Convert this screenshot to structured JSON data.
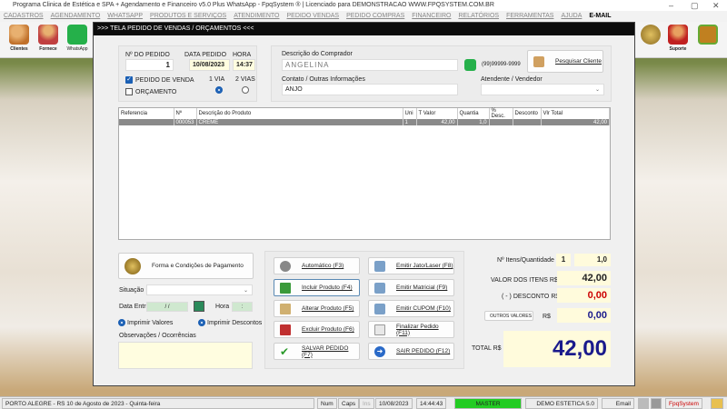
{
  "window": {
    "title": "Programa Clinica de Estética e SPA + Agendamento e Financeiro v5.0 Plus WhatsApp - FpqSystem ® | Licenciado para  DEMONSTRACAO WWW.FPQSYSTEM.COM.BR",
    "minimize": "–",
    "maximize": "▢",
    "close": "✕"
  },
  "menu": [
    "CADASTROS",
    "AGENDAMENTO",
    "WHATSAPP",
    "PRODUTOS E SERVIÇOS",
    "ATENDIMENTO",
    "PEDIDO VENDAS",
    "PEDIDO COMPRAS",
    "FINANCEIRO",
    "RELATÓRIOS",
    "FERRAMENTAS",
    "AJUDA"
  ],
  "menu_email": "E-MAIL",
  "toolbar": {
    "clientes": "Clientes",
    "fornece": "Fornece",
    "whatsapp": "WhatsApp",
    "suporte": "Suporte"
  },
  "modal": {
    "title": ">>>  TELA PEDIDO DE VENDAS / ORÇAMENTOS  <<<",
    "order_no_label": "Nº DO PEDIDO",
    "order_no": "1",
    "date_label": "DATA PEDIDO",
    "date": "10/08/2023",
    "time_label": "HORA",
    "time": "14:37",
    "sale_order": "PEDIDO DE VENDA",
    "quote": "ORÇAMENTO",
    "via1": "1 VIA",
    "via2": "2 VIAS",
    "buyer_label": "Descrição do Comprador",
    "buyer": "ANGELINA",
    "phone": "(99)99999-9999",
    "search_client": "Pesquisar Cliente",
    "contact_label": "Contato / Outras Informações",
    "contact": "ANJO",
    "seller_label": "Atendente / Vendedor",
    "seller": "",
    "table": {
      "headers": [
        "Referencia",
        "Nº",
        "Descrição do Produto",
        "Uni",
        "T Valor",
        "Quantia",
        "% Desc.",
        "Desconto",
        "Vlr Total"
      ],
      "rows": [
        [
          "",
          "000053",
          "CREME",
          "",
          "1",
          "42,00",
          "1,0",
          "",
          "",
          "42,00"
        ]
      ]
    },
    "payment_button": "Forma e Condições de Pagamento",
    "status_label": "Situação",
    "status": "",
    "delivery_label": "Data Entrega",
    "delivery_date": " / / ",
    "hour_label": "Hora",
    "hour": ":",
    "print_values": "Imprimir Valores",
    "print_discounts": "Imprimir Descontos",
    "notes_label": "Observações / Ocorrências",
    "notes": "",
    "buttons": {
      "auto": "Automático   (F3)",
      "include": "Incluir Produto  (F4)",
      "alter": "Alterar Produto  (F5)",
      "delete": "Excluir Produto  (F6)",
      "save": "SALVAR PEDIDO (F7)",
      "jet": "Emitir Jato/Laser (F8)",
      "matrix": "Emitir Matricial  (F9)",
      "coupon": "Emitir CUPOM  (F10)",
      "finish": "Finalizar Pedido  (F11)",
      "exit": "SAIR  PEDIDO  (F12)"
    },
    "items_label": "Nº Itens/Quantidade",
    "items_count": "1",
    "items_qty": "1,0",
    "items_value_label": "VALOR DOS ITENS R$",
    "items_value": "42,00",
    "discount_label": "( - ) DESCONTO R$",
    "discount": "0,00",
    "other_button": "OUTROS VALORES",
    "other_currency": "R$",
    "other": "0,00",
    "total_label": "TOTAL R$",
    "total": "42,00"
  },
  "statusbar": {
    "location": "PORTO ALEGRE - RS 10 de Agosto de 2023 - Quinta-feira",
    "num": "Num",
    "caps": "Caps",
    "ins": "Ins",
    "date": "10/08/2023",
    "time": "14:44:43",
    "user": "MASTER",
    "db": "DEMO ESTETICA 5.0",
    "email": "Email",
    "brand": "FpqSystem"
  },
  "colors": {
    "accent": "#1a5fb4",
    "total": "#1a1a8c",
    "discount": "#cc0000",
    "master": "#22cc22"
  }
}
